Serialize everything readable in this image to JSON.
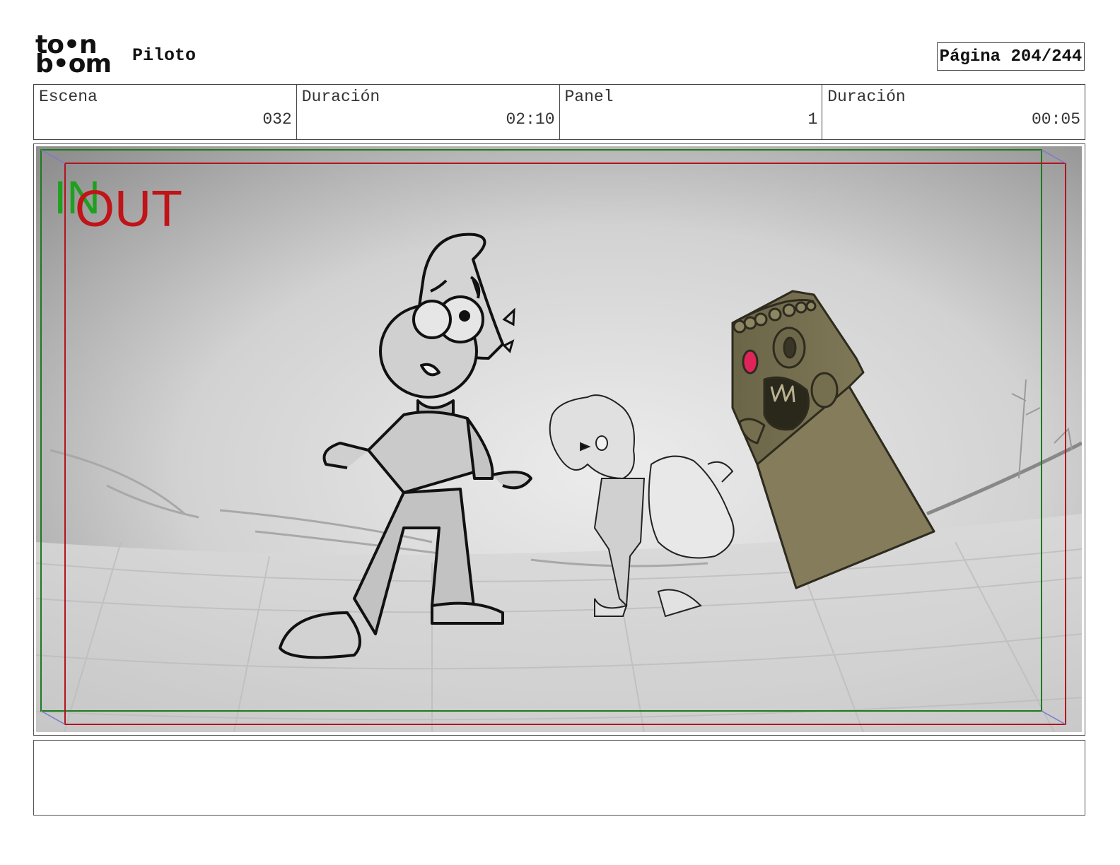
{
  "header": {
    "logo_line1": "to•n",
    "logo_line2": "b•om",
    "project_title": "Piloto",
    "page_label": "Página 204/244"
  },
  "info": {
    "cells": [
      {
        "label": "Escena",
        "value": "032"
      },
      {
        "label": "Duración",
        "value": "02:10"
      },
      {
        "label": "Panel",
        "value": "1"
      },
      {
        "label": "Duración",
        "value": "00:05"
      }
    ]
  },
  "panel": {
    "in_label": "IN",
    "out_label": "OUT",
    "colors": {
      "in_frame": "#1e7a1e",
      "out_frame": "#b3141e",
      "statue": "#7a7355",
      "eye_glow": "#e0245a"
    }
  },
  "notes": {
    "text": ""
  }
}
